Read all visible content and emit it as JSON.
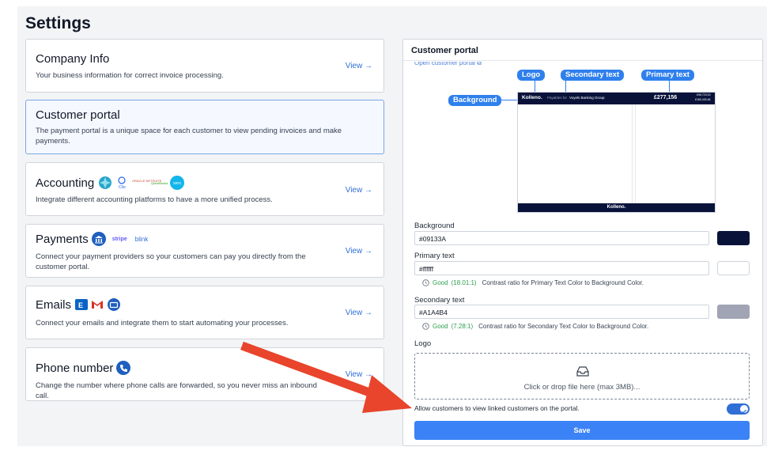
{
  "page": {
    "title": "Settings"
  },
  "sections": [
    {
      "title": "Company Info",
      "desc": "Your business information for correct invoice processing.",
      "action": "View →"
    },
    {
      "title": "Customer portal",
      "desc": "The payment portal is a unique space for each customer to view pending invoices and make payments.",
      "action": ""
    },
    {
      "title": "Accounting",
      "desc": "Integrate different accounting platforms to have a more unified process.",
      "action": "View →",
      "logos": [
        "quickbooks-logo",
        "clio-logo",
        "oracle-netsuite-logo",
        "quickbooks-online-logo",
        "xero-logo"
      ],
      "logo_text": {
        "clio": "Clio",
        "oracle": "ORACLE NETSUITE",
        "qb": "QuickBooks",
        "xero": "xero"
      }
    },
    {
      "title": "Payments",
      "desc": "Connect your payment providers so your customers can pay you directly from the customer portal.",
      "action": "View →",
      "logo_text": {
        "stripe": "stripe",
        "blink": "blink"
      }
    },
    {
      "title": "Emails",
      "desc": "Connect your emails and integrate them to start automating your processes.",
      "action": "View →"
    },
    {
      "title": "Phone number",
      "desc": "Change the number where phone calls are forwarded, so you never miss an inbound call.",
      "action": "View →"
    }
  ],
  "panel": {
    "title": "Customer portal",
    "link_partial": "Open customer portal ⧉",
    "callouts": {
      "logo": "Logo",
      "secondary": "Secondary text",
      "primary": "Primary text",
      "background": "Background"
    },
    "preview": {
      "brand": "Kolleno.",
      "payables_prefix": "Payables for",
      "payables_company": "Voyels Banking Group",
      "amount": "£277,156",
      "small_rows": [
        "£96,723.00",
        "£180,433.46"
      ],
      "footer_brand": "Kolleno."
    },
    "fields": {
      "background": {
        "label": "Background",
        "value": "#09133A",
        "color": "#09133A"
      },
      "primary": {
        "label": "Primary text",
        "value": "#ffffff",
        "color": "#ffffff",
        "rating": "Good",
        "ratio": "(18.01:1)",
        "note": "Contrast ratio for Primary Text Color to Background Color."
      },
      "secondary": {
        "label": "Secondary text",
        "value": "#A1A4B4",
        "color": "#A1A4B4",
        "rating": "Good",
        "ratio": "(7.28:1)",
        "note": "Contrast ratio for Secondary Text Color to Background Color."
      }
    },
    "logo": {
      "label": "Logo",
      "drop_text": "Click or drop file here (max 3MB)..."
    },
    "allow_linked": {
      "label": "Allow customers to view linked customers on the portal.",
      "enabled": true
    },
    "save_label": "Save"
  },
  "colors": {
    "accent": "#3b82f6",
    "annotation_arrow": "#e8452c",
    "callout": "#2f80ed"
  }
}
